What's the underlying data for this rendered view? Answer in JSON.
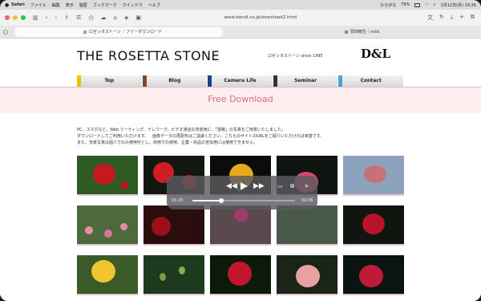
{
  "menubar": {
    "app": "Safari",
    "items": [
      "ファイル",
      "編集",
      "表示",
      "履歴",
      "ブックマーク",
      "ウインドウ",
      "ヘルプ"
    ],
    "battery": "79%",
    "datetime": "1月12日(月) 19:26",
    "input_label": "ひらがな"
  },
  "toolbar": {
    "url": "www.dandl.co.jp/download2.html"
  },
  "tabs": [
    {
      "label": "ロゼッタストーン ｜フリーダウンロード"
    },
    {
      "label": "原田敏生｜note"
    }
  ],
  "site": {
    "title": "THE ROSETTA STONE",
    "subtitle": "ロゼッタストーン since 1995",
    "logo": "D&L",
    "nav": [
      {
        "label": "Top",
        "color": "#f2c200"
      },
      {
        "label": "Blog",
        "color": "#7a4a2a"
      },
      {
        "label": "Camera Life",
        "color": "#1f3f8a"
      },
      {
        "label": "Seminar",
        "color": "#333333"
      },
      {
        "label": "Contact",
        "color": "#4aa3e0"
      }
    ],
    "banner": "Free Download",
    "intro": [
      "PC、スマホなど、Web ミーティング、テレワーク、ビデオ通話の背景用に、「薔薇」の写真をご用意いたしました。",
      "ダウンロードしてご利用いただけます。ㅤ画像データの再配布はご遠慮ください。こちらのサイトのURLをご紹介いただければ幸甚です。",
      "また、背景写真は個人でのみ使用可とし、商用での使用、企業・商品の宣伝用には使用できません。"
    ]
  },
  "player": {
    "elapsed": "01:20",
    "remaining": "00:06",
    "progress": 0.28
  }
}
